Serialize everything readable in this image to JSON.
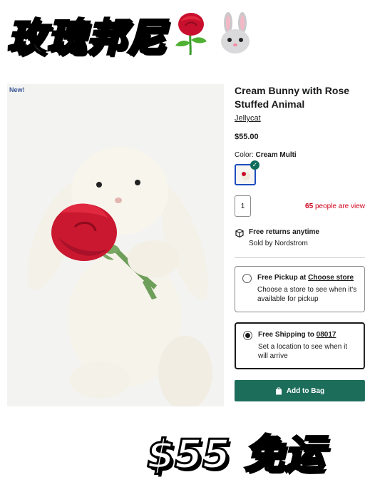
{
  "overlay": {
    "title_cn": "玫瑰邦尼",
    "price_note": "$55 免运",
    "emoji_1": "rose-emoji",
    "emoji_2": "bunny-emoji"
  },
  "product": {
    "new_tag": "New!",
    "title": "Cream Bunny with Rose Stuffed Animal",
    "brand": "Jellycat",
    "price": "$55.00",
    "color_label": "Color:",
    "color_value": "Cream Multi",
    "quantity": "1",
    "viewing_count": "65",
    "viewing_text": "people are view"
  },
  "returns": {
    "title": "Free returns anytime",
    "sold_by": "Sold by Nordstrom",
    "icon": "return-box-icon"
  },
  "pickup": {
    "label": "Free Pickup at ",
    "link": "Choose store",
    "desc": "Choose a store to see when it's available for pickup"
  },
  "shipping": {
    "label": "Free Shipping to ",
    "zip": "08017",
    "desc": "Set a location to see when it will arrive"
  },
  "cta": {
    "add_to_bag": "Add to Bag"
  },
  "colors": {
    "brand_green": "#1d6d5b",
    "alert_red": "#d0021b",
    "new_blue": "#3b5998"
  }
}
